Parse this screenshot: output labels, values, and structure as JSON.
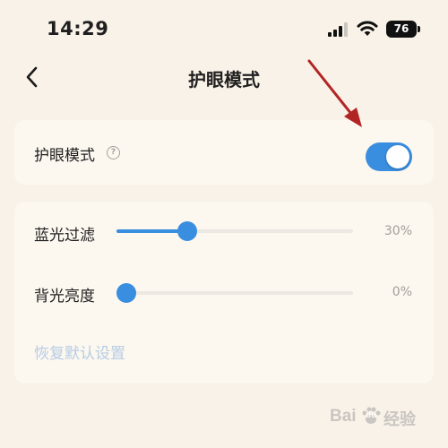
{
  "status_bar": {
    "time": "14:29",
    "battery": "76"
  },
  "nav": {
    "title": "护眼模式",
    "back_icon": "chevron-left-icon"
  },
  "eye_care": {
    "label": "护眼模式",
    "help_icon": "help-icon",
    "help_glyph": "?",
    "enabled": true
  },
  "settings": {
    "blue_light": {
      "label": "蓝光过滤",
      "value_text": "30%",
      "value": 0.3
    },
    "backlight": {
      "label": "背光亮度",
      "value_text": "0%",
      "value": 0.0
    },
    "reset": "恢复默认设置"
  },
  "watermark": {
    "brand": "Bai",
    "suffix": "经验",
    "du": "du"
  },
  "colors": {
    "accent": "#3a8ee0",
    "background": "#f9f2e8",
    "card": "#fcf7ef",
    "annotation_arrow": "#b22525",
    "reset_link": "#b6cde5"
  }
}
